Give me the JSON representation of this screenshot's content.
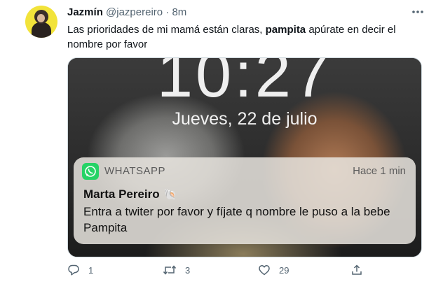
{
  "tweet": {
    "author_name": "Jazmín",
    "author_handle": "@jazpereiro",
    "separator": " · ",
    "age": "8m",
    "text_before": "Las prioridades de mi mamá están claras, ",
    "text_bold": "pampita",
    "text_after": " apúrate en decir el nombre por favor",
    "more_icon": "more-icon"
  },
  "image": {
    "clock": "10:27",
    "date": "Jueves, 22 de julio",
    "notification": {
      "app": "WHATSAPP",
      "time": "Hace 1 min",
      "sender": "Marta Pereiro",
      "sender_emoji": "🐚",
      "message": "Entra a twiter por favor y fíjate q nombre le puso a la bebe Pampita"
    }
  },
  "actions": {
    "replies": "1",
    "retweets": "3",
    "likes": "29"
  },
  "colors": {
    "text": "#0f1419",
    "secondary": "#536471",
    "whatsapp": "#25d366"
  }
}
